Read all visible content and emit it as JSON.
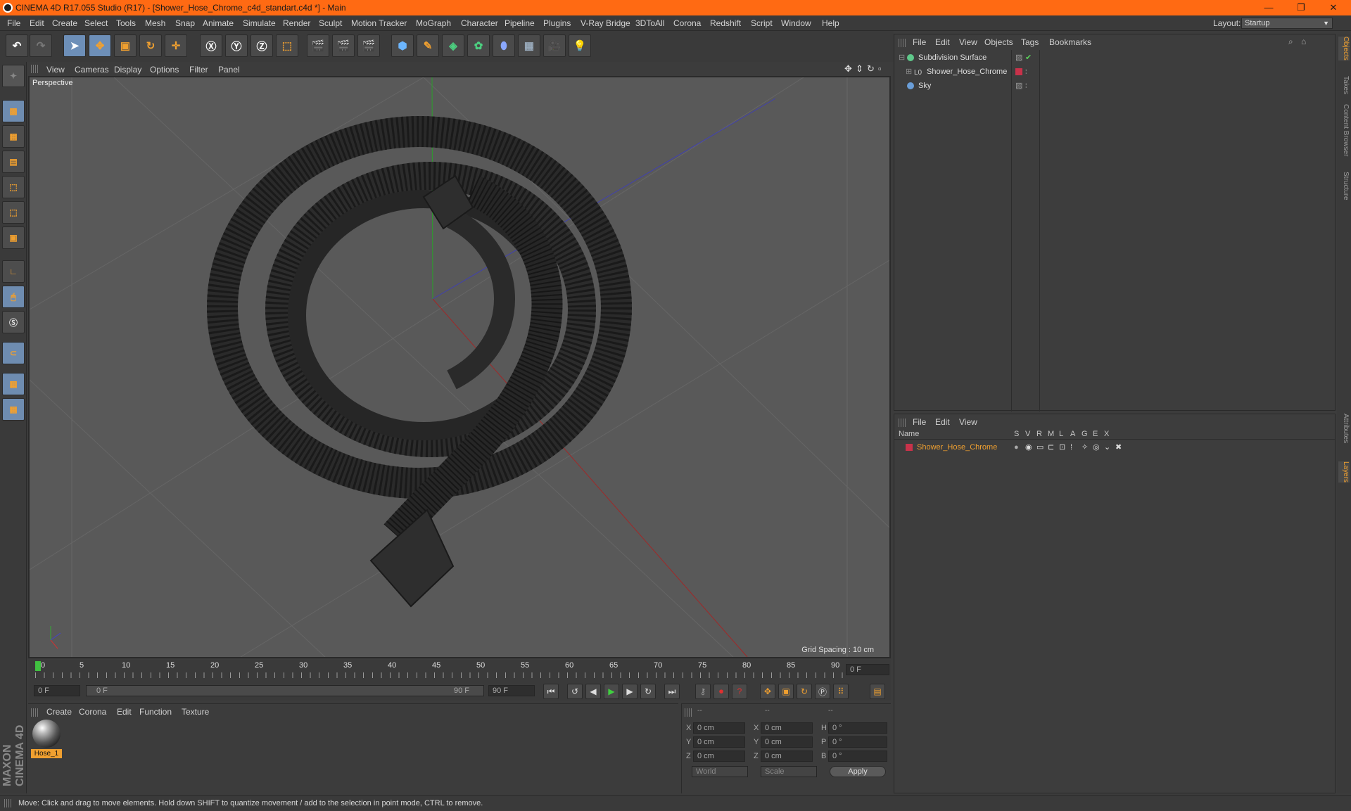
{
  "window": {
    "title": "CINEMA 4D R17.055 Studio (R17) - [Shower_Hose_Chrome_c4d_standart.c4d *] - Main"
  },
  "menu": [
    "File",
    "Edit",
    "Create",
    "Select",
    "Tools",
    "Mesh",
    "Snap",
    "Animate",
    "Simulate",
    "Render",
    "Sculpt",
    "Motion Tracker",
    "MoGraph",
    "Character",
    "Pipeline",
    "Plugins",
    "V-Ray Bridge",
    "3DToAll",
    "Corona",
    "Redshift",
    "Script",
    "Window",
    "Help"
  ],
  "layout": {
    "label": "Layout:",
    "value": "Startup"
  },
  "viewport": {
    "menu": [
      "View",
      "Cameras",
      "Display",
      "Options",
      "Filter",
      "Panel"
    ],
    "camera_label": "Perspective",
    "grid_spacing": "Grid Spacing : 10 cm"
  },
  "timeline": {
    "ticks": [
      "0",
      "5",
      "10",
      "15",
      "20",
      "25",
      "30",
      "35",
      "40",
      "45",
      "50",
      "55",
      "60",
      "65",
      "70",
      "75",
      "80",
      "85",
      "90"
    ],
    "current_frame": "0 F",
    "start_field": "0 F",
    "range_start": "0 F",
    "range_end": "90 F",
    "end_field": "90 F"
  },
  "material_manager": {
    "menu": [
      "Create",
      "Corona",
      "Edit",
      "Function",
      "Texture"
    ],
    "materials": [
      {
        "name": "Hose_1"
      }
    ]
  },
  "coordinates": {
    "headers": [
      "--",
      "--",
      "--"
    ],
    "rows": [
      {
        "a": "X",
        "v1": "0 cm",
        "b": "X",
        "v2": "0 cm",
        "c": "H",
        "v3": "0 °"
      },
      {
        "a": "Y",
        "v1": "0 cm",
        "b": "Y",
        "v2": "0 cm",
        "c": "P",
        "v3": "0 °"
      },
      {
        "a": "Z",
        "v1": "0 cm",
        "b": "Z",
        "v2": "0 cm",
        "c": "B",
        "v3": "0 °"
      }
    ],
    "mode": "World",
    "scale": "Scale",
    "apply": "Apply"
  },
  "object_manager": {
    "menu": [
      "File",
      "Edit",
      "View",
      "Objects",
      "Tags",
      "Bookmarks"
    ],
    "objects": [
      {
        "name": "Subdivision Surface"
      },
      {
        "name": "Shower_Hose_Chrome"
      },
      {
        "name": "Sky"
      }
    ]
  },
  "layer_manager": {
    "menu": [
      "File",
      "Edit",
      "View"
    ],
    "columns": [
      "Name",
      "S",
      "V",
      "R",
      "M",
      "L",
      "A",
      "G",
      "E",
      "X"
    ],
    "layers": [
      {
        "name": "Shower_Hose_Chrome",
        "color": "#c8324a"
      }
    ]
  },
  "right_tabs": [
    "Objects",
    "Takes",
    "Content Browser",
    "Structure",
    "Attributes",
    "Layers"
  ],
  "status": "Move: Click and drag to move elements. Hold down SHIFT to quantize movement / add to the selection in point mode, CTRL to remove.",
  "colors": {
    "accent": "#ff6a13",
    "selected_text": "#f0a030",
    "layer": "#c8324a"
  }
}
